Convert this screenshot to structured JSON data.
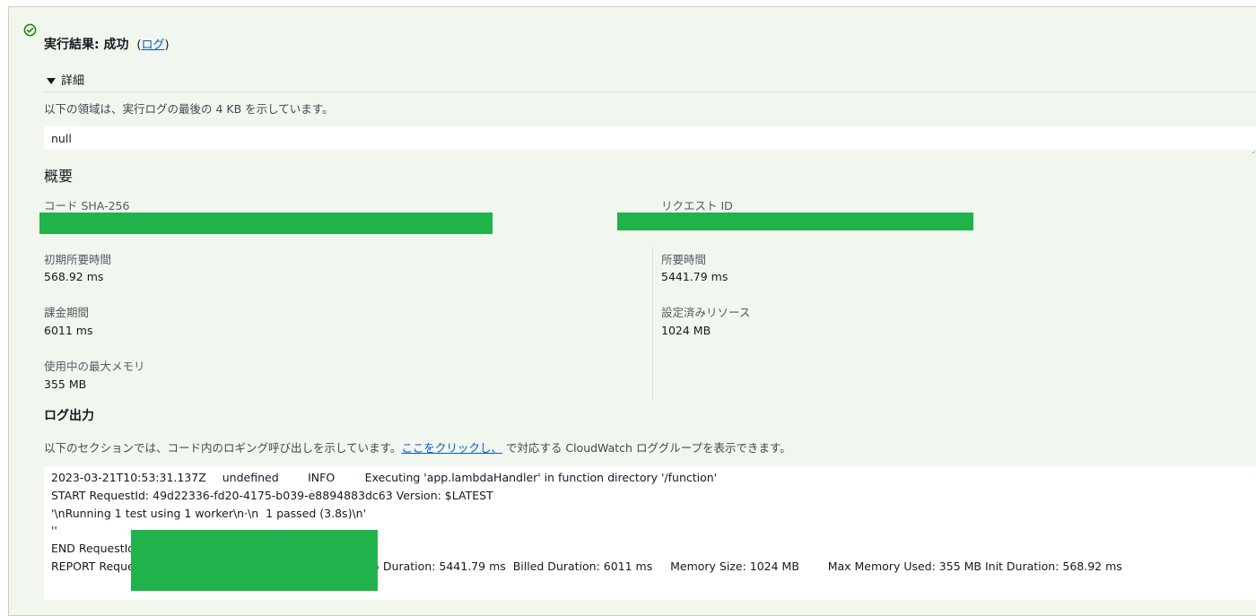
{
  "result": {
    "status_title": "実行結果: 成功",
    "log_link_open": "(",
    "log_link_label": "ログ",
    "log_link_close": ")"
  },
  "details": {
    "toggle_label": "詳細",
    "description": "以下の領域は、実行ログの最後の 4 KB を示しています。",
    "output_value": "null"
  },
  "summary": {
    "heading": "概要",
    "code_sha_label": "コード SHA-256",
    "request_id_label": "リクエスト ID",
    "init_duration_label": "初期所要時間",
    "init_duration_value": "568.92 ms",
    "duration_label": "所要時間",
    "duration_value": "5441.79 ms",
    "billed_duration_label": "課金期間",
    "billed_duration_value": "6011 ms",
    "configured_resources_label": "設定済みリソース",
    "configured_resources_value": "1024 MB",
    "max_memory_label": "使用中の最大メモリ",
    "max_memory_value": "355 MB"
  },
  "log_output": {
    "heading": "ログ出力",
    "description_prefix": "以下のセクションでは、コード内のロギング呼び出しを示しています。",
    "link_label": "ここをクリックし、",
    "description_suffix": " で対応する CloudWatch ロググループを表示できます。",
    "lines": [
      "2023-03-21T10:53:31.137Z\tundefined\tINFO\tExecuting 'app.lambdaHandler' in function directory '/function'",
      "START RequestId: 49d22336-fd20-4175-b039-e8894883dc63 Version: $LATEST",
      "'\\nRunning 1 test using 1 worker\\n·\\n  1 passed (3.8s)\\n'",
      "''",
      "END RequestId:",
      "REPORT Reques",
      "5 Duration: 5441.79 ms  Billed Duration: 6011 ms     Memory Size: 1024 MB        Max Memory Used: 355 MB Init Duration: 568.92 ms"
    ]
  },
  "colors": {
    "panel_bg": "#f1f7ee",
    "success_green": "#1d8102",
    "link_blue": "#0a58ca",
    "redaction_green": "#21b34b"
  },
  "icons": {
    "status": "check-circle-icon",
    "toggle": "caret-down-icon"
  }
}
